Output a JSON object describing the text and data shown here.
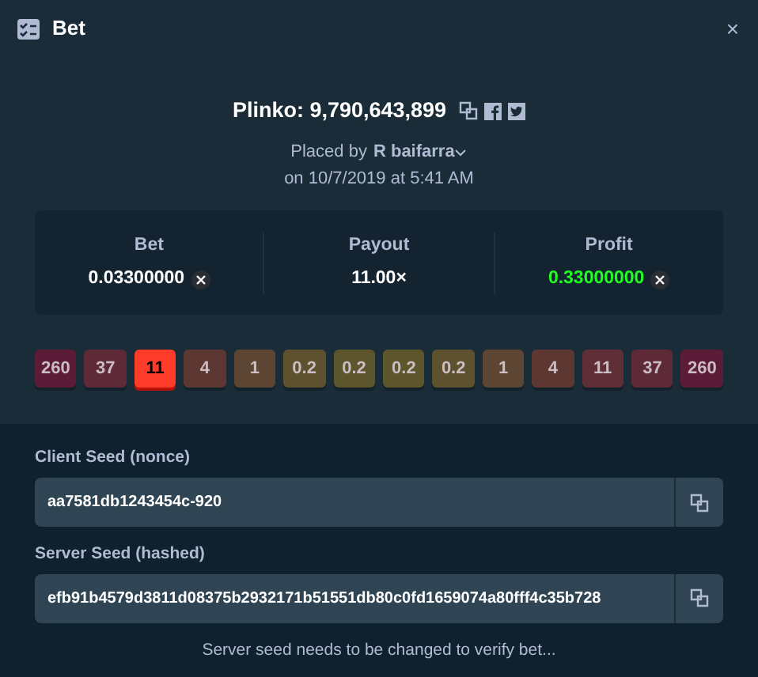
{
  "window": {
    "title": "Bet",
    "close": "×"
  },
  "bet": {
    "title": "Plinko: 9,790,643,899",
    "placed_by_label": "Placed by",
    "user": "R baifarra",
    "date": "on 10/7/2019 at 5:41 AM"
  },
  "stats": [
    {
      "label": "Bet",
      "value": "0.03300000",
      "kind": "currency",
      "color": "#ffffff"
    },
    {
      "label": "Payout",
      "value": "11.00×",
      "kind": "plain",
      "color": "#ffffff"
    },
    {
      "label": "Profit",
      "value": "0.33000000",
      "kind": "currency",
      "color": "#1fff20"
    }
  ],
  "buckets": [
    {
      "label": "260",
      "color": "#5c1c37",
      "selected": false
    },
    {
      "label": "37",
      "color": "#5f2a37",
      "selected": false
    },
    {
      "label": "11",
      "color": "#ff3b2a",
      "selected": true
    },
    {
      "label": "4",
      "color": "#5d3832",
      "selected": false
    },
    {
      "label": "1",
      "color": "#5d4533",
      "selected": false
    },
    {
      "label": "0.2",
      "color": "#5d522d",
      "selected": false
    },
    {
      "label": "0.2",
      "color": "#5d552c",
      "selected": false
    },
    {
      "label": "0.2",
      "color": "#5d552c",
      "selected": false
    },
    {
      "label": "0.2",
      "color": "#5d522d",
      "selected": false
    },
    {
      "label": "1",
      "color": "#5d4533",
      "selected": false
    },
    {
      "label": "4",
      "color": "#5d3832",
      "selected": false
    },
    {
      "label": "11",
      "color": "#5f2e37",
      "selected": false
    },
    {
      "label": "37",
      "color": "#5f2a37",
      "selected": false
    },
    {
      "label": "260",
      "color": "#5c1c37",
      "selected": false
    }
  ],
  "seeds": [
    {
      "label": "Client Seed (nonce)",
      "value": "aa7581db1243454c-920"
    },
    {
      "label": "Server Seed (hashed)",
      "value": "efb91b4579d3811d08375b2932171b51551db80c0fd1659074a80fff4c35b728"
    }
  ],
  "footer_note": "Server seed needs to be changed to verify bet..."
}
